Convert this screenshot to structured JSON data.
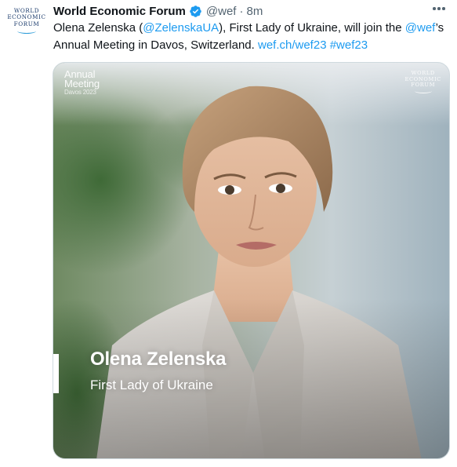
{
  "tweet": {
    "author": {
      "avatar_logo_lines": [
        "WORLD",
        "ECONOMIC",
        "FORUM"
      ],
      "name": "World Economic Forum",
      "verified_icon": "verified-badge-icon",
      "handle": "@wef",
      "separator": "·",
      "time": "8m"
    },
    "more_icon": "more-options-icon",
    "text": {
      "part1": "Olena Zelenska (",
      "mention1": "@ZelenskaUA",
      "part2": "), First Lady of Ukraine, will join the ",
      "mention2": "@wef",
      "part3": "’s Annual Meeting in Davos, Switzerland. ",
      "link": "wef.ch/wef23",
      "space": " ",
      "hashtag": "#wef23"
    },
    "media": {
      "event_label_lines": [
        "Annual",
        "Meeting"
      ],
      "event_sub": "Davos 2023",
      "logo_lines": [
        "WORLD",
        "ECONOMIC",
        "FORUM"
      ],
      "person_name": "Olena Zelenska",
      "person_title": "First Lady of Ukraine"
    },
    "colors": {
      "link": "#1d9bf0",
      "verified": "#1d9bf0",
      "secondary_text": "#536471"
    }
  }
}
